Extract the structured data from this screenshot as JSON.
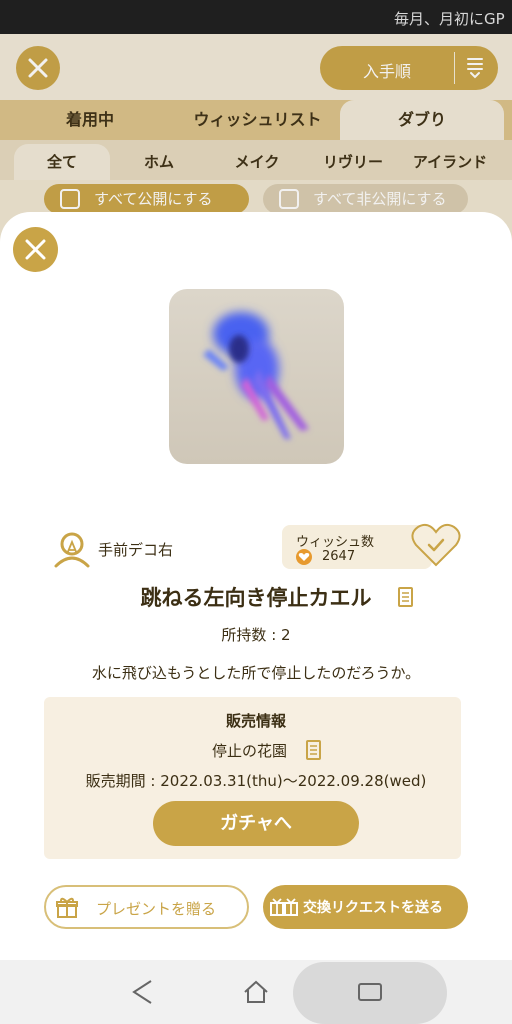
{
  "status": {
    "notification": "毎月、月初にGP"
  },
  "header": {
    "sort_label": "入手順"
  },
  "tabs": [
    {
      "label": "着用中"
    },
    {
      "label": "ウィッシュリスト"
    },
    {
      "label": "ダブり"
    }
  ],
  "subtabs": [
    {
      "label": "全て"
    },
    {
      "label": "ホム"
    },
    {
      "label": "メイク"
    },
    {
      "label": "リヴリー"
    },
    {
      "label": "アイランド"
    }
  ],
  "bulk": {
    "public_label": "すべて公開にする",
    "private_label": "すべて非公開にする"
  },
  "item": {
    "category": "手前デコ右",
    "wish_label": "ウィッシュ数",
    "wish_count": "2647",
    "name": "跳ねる左向き停止カエル",
    "owned": "所持数 : 2",
    "description": "水に飛び込もうとした所で停止したのだろうか。"
  },
  "sale": {
    "title": "販売情報",
    "place": "停止の花園",
    "period": "販売期間 : 2022.03.31(thu)〜2022.09.28(wed)",
    "gacha_button": "ガチャへ"
  },
  "actions": {
    "present": "プレゼントを贈る",
    "trade": "交換リクエストを送る"
  },
  "colors": {
    "accent": "#c9a447",
    "panel": "#f7efe1",
    "text": "#3c2f14"
  }
}
